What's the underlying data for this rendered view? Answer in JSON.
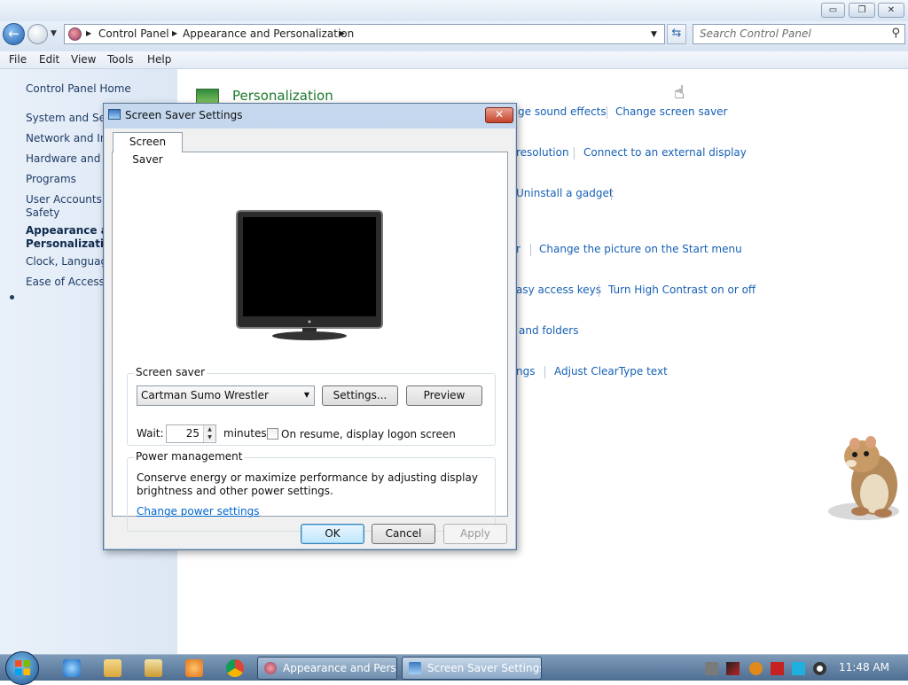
{
  "window": {
    "minimize_glyph": "▭",
    "maximize_glyph": "❐",
    "close_glyph": "✕"
  },
  "address": {
    "crumbs": [
      "Control Panel",
      "Appearance and Personalization"
    ],
    "search_placeholder": "Search Control Panel"
  },
  "menubar": [
    "File",
    "Edit",
    "View",
    "Tools",
    "Help"
  ],
  "leftnav": {
    "items": [
      "Control Panel Home",
      "System and Secu",
      "Network and Int",
      "Hardware and So",
      "Programs",
      "User Accounts ar",
      "Safety",
      "Appearance and",
      "Personalization",
      "Clock, Language",
      "Ease of Access"
    ]
  },
  "content": {
    "category_title": "Personalization",
    "tasks": [
      "ge sound effects",
      "Change screen saver",
      "resolution",
      "Connect to an external display",
      "Uninstall a gadget",
      "r",
      "Change the picture on the Start menu",
      "asy access keys",
      "Turn High Contrast on or off",
      "and folders",
      "ngs",
      "Adjust ClearType text"
    ]
  },
  "dialog": {
    "title": "Screen Saver Settings",
    "close_glyph": "✕",
    "tab": "Screen Saver",
    "screensaver_group": "Screen saver",
    "screensaver_selected": "Cartman Sumo Wrestler",
    "settings_button": "Settings...",
    "preview_button": "Preview",
    "wait_label": "Wait:",
    "wait_value": "25",
    "minutes_label": "minutes",
    "resume_checkbox": "On resume, display logon screen",
    "resume_checked": false,
    "power_group": "Power management",
    "power_desc_1": "Conserve energy or maximize performance by adjusting display",
    "power_desc_2": "brightness and other power settings.",
    "power_link": "Change power settings",
    "ok_button": "OK",
    "cancel_button": "Cancel",
    "apply_button": "Apply"
  },
  "taskbar": {
    "tasks": [
      "Appearance and Pers...",
      "Screen Saver Settings"
    ],
    "clock": "11:48 AM"
  },
  "colors": {
    "link": "#1660b5",
    "category_title": "#1c7a2c",
    "dialog_frame": "#a9c2e0"
  }
}
